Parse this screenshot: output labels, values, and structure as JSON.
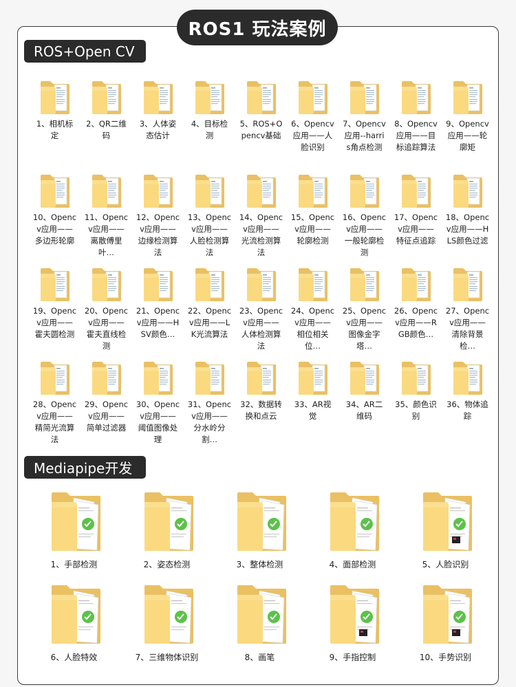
{
  "header": {
    "title": "ROS1 玩法案例"
  },
  "section1": {
    "title": "ROS+Open CV",
    "items": [
      "1、相机标定",
      "2、QR二维码",
      "3、人体姿态估计",
      "4、目标检测",
      "5、ROS+Opencv基础",
      "6、Opencv应用——人脸识别",
      "7、Opencv应用--harris角点检测",
      "8、Opencv应用——目标追踪算法",
      "9、Opencv应用——轮廓矩",
      "10、Opencv应用——多边形轮廓",
      "11、Opencv应用——离散傅里叶…",
      "12、Opencv应用——边缘检测算法",
      "13、Opencv应用——人脸检测算法",
      "14、Opencv应用——光流检测算法",
      "15、Opencv应用——轮廓检测",
      "16、Opencv应用——一般轮廓检测",
      "17、Opencv应用——特征点追踪",
      "18、Opencv应用——HLS颜色过滤",
      "19、Opencv应用——霍夫圆检测",
      "20、Opencv应用——霍夫直线检测",
      "21、Opencv应用——HSV颜色…",
      "22、Opencv应用——LK光流算法",
      "23、Opencv应用——人体检测算法",
      "24、Opencv应用——相位相关位…",
      "25、Opencv应用——图像金字塔…",
      "26、Opencv应用——RGB颜色…",
      "27、Opencv应用——清除背景检…",
      "28、Opencv应用——精简光流算法",
      "29、Opencv应用——简单过滤器",
      "30、Opencv应用——阈值图像处理",
      "31、Opencv应用——分水岭分割…",
      "32、数据转换和点云",
      "33、AR视觉",
      "34、AR二维码",
      "35、颜色识别",
      "36、物体追踪"
    ]
  },
  "section2": {
    "title": "Mediapipe开发",
    "items": [
      "1、手部检测",
      "2、姿态检测",
      "3、整体检测",
      "4、面部检测",
      "5、人脸识别",
      "6、人脸特效",
      "7、三维物体识别",
      "8、画笔",
      "9、手指控制",
      "10、手势识别"
    ]
  },
  "colors": {
    "folder_back": "#eac063",
    "folder_front": "#fad97f",
    "label_bg": "#2b2b2b",
    "accent_green": "#5cc24a"
  }
}
